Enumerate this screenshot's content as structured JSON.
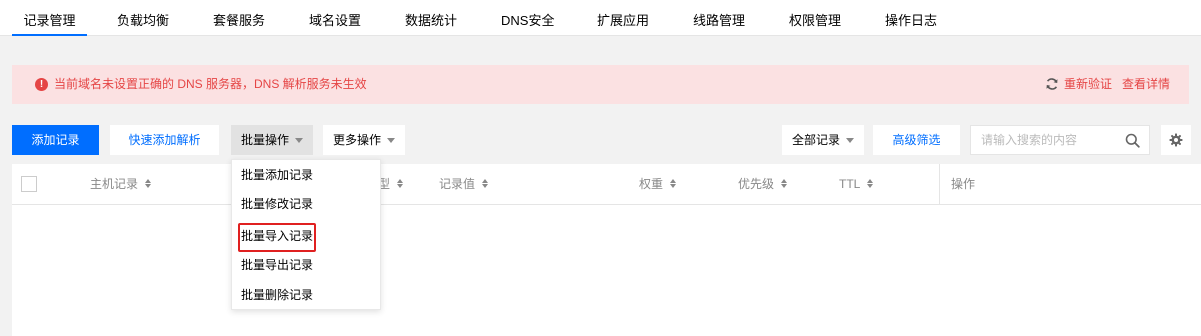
{
  "tabs": [
    {
      "label": "记录管理",
      "active": true
    },
    {
      "label": "负载均衡"
    },
    {
      "label": "套餐服务"
    },
    {
      "label": "域名设置"
    },
    {
      "label": "数据统计"
    },
    {
      "label": "DNS安全"
    },
    {
      "label": "扩展应用"
    },
    {
      "label": "线路管理"
    },
    {
      "label": "权限管理"
    },
    {
      "label": "操作日志"
    }
  ],
  "alert": {
    "icon": "exclamation-circle-icon",
    "message": "当前域名未设置正确的 DNS 服务器，DNS 解析服务未生效",
    "revalidate_label": "重新验证",
    "details_label": "查看详情",
    "color": "#e54545",
    "background": "#fbe1e2"
  },
  "toolbar": {
    "add_record": "添加记录",
    "quick_add": "快速添加解析",
    "batch_ops": "批量操作",
    "more_ops": "更多操作",
    "record_filter": "全部记录",
    "advanced_filter": "高级筛选",
    "search_placeholder": "请输入搜索的内容",
    "accent_color": "#006eff"
  },
  "table": {
    "columns": [
      "主机记录",
      "记录类型",
      "记录值",
      "权重",
      "优先级",
      "TTL",
      "操作"
    ]
  },
  "batch_menu": {
    "items": [
      "批量添加记录",
      "批量修改记录",
      "批量导入记录",
      "批量导出记录",
      "批量删除记录"
    ],
    "highlighted_item": "批量导入记录"
  }
}
